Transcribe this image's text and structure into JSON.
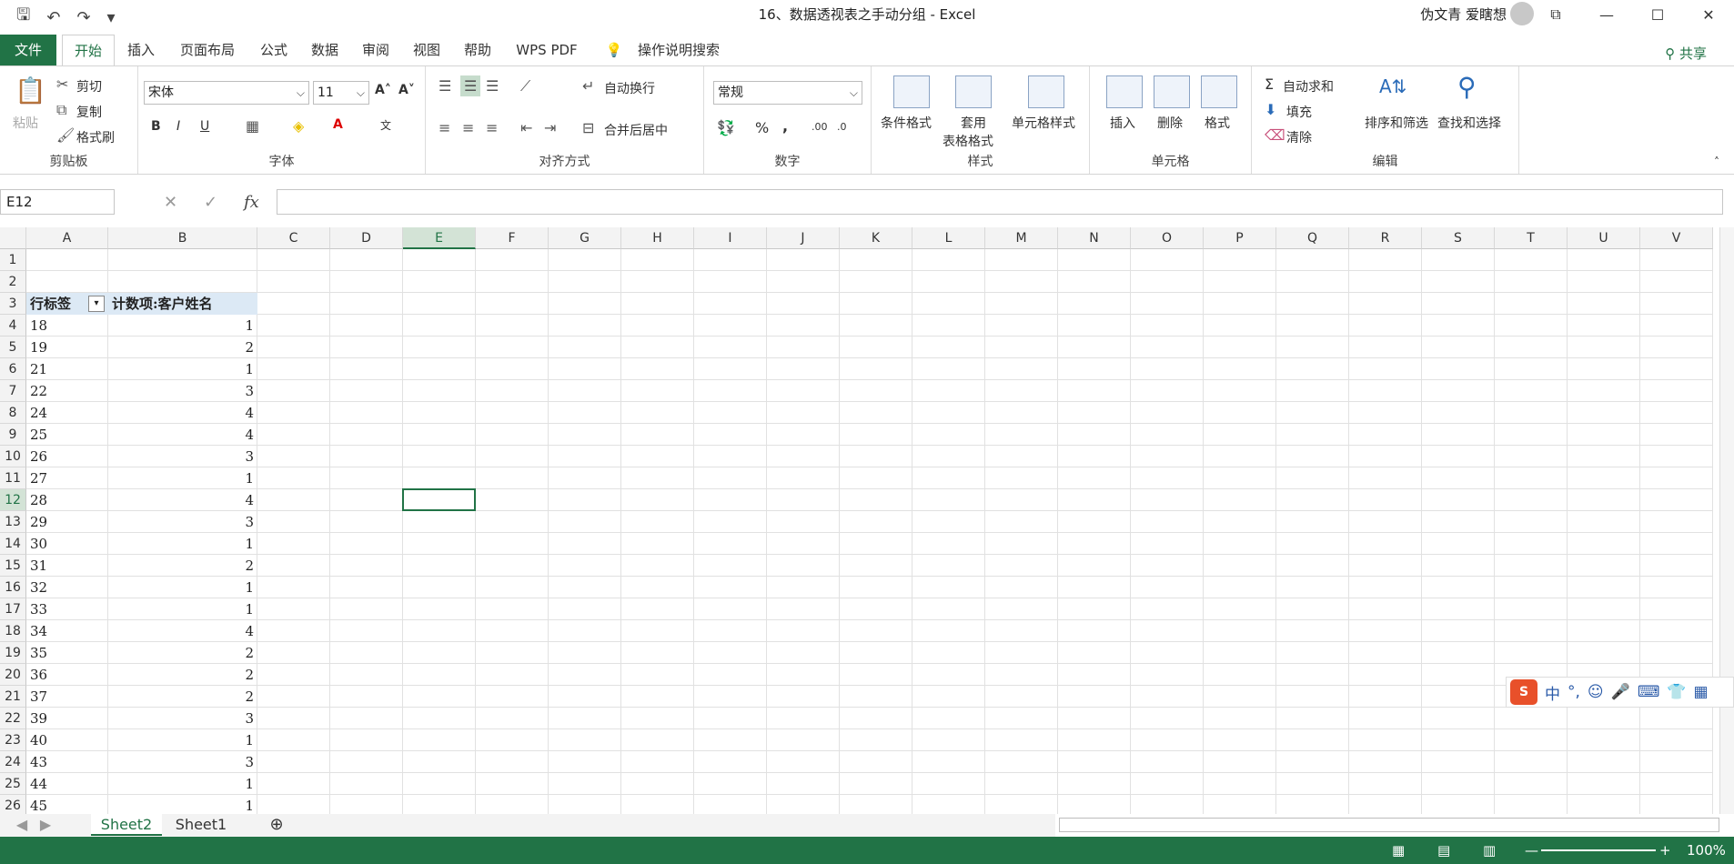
{
  "window": {
    "title": "16、数据透视表之手动分组  -  Excel",
    "user": "伪文青 爱瞎想"
  },
  "ribbon_tabs": [
    "文件",
    "开始",
    "插入",
    "页面布局",
    "公式",
    "数据",
    "审阅",
    "视图",
    "帮助",
    "WPS PDF",
    "操作说明搜索"
  ],
  "share_label": "共享",
  "clipboard": {
    "paste": "粘贴",
    "cut": "剪切",
    "copy": "复制",
    "format_painter": "格式刷",
    "label": "剪贴板"
  },
  "font": {
    "name": "宋体",
    "size": "11",
    "label": "字体"
  },
  "alignment": {
    "wrap": "自动换行",
    "merge": "合并后居中",
    "label": "对齐方式"
  },
  "number": {
    "format": "常规",
    "label": "数字"
  },
  "styles": {
    "conditional": "条件格式",
    "table_1": "套用",
    "table_2": "表格格式",
    "cell_styles": "单元格样式",
    "label": "样式"
  },
  "cells": {
    "insert": "插入",
    "delete": "删除",
    "format": "格式",
    "label": "单元格"
  },
  "editing": {
    "autosum": "自动求和",
    "fill": "填充",
    "clear": "清除",
    "sort": "排序和筛选",
    "find": "查找和选择",
    "label": "编辑"
  },
  "formula_bar": {
    "name_box": "E12",
    "fx": "fx",
    "value": ""
  },
  "columns": [
    "A",
    "B",
    "C",
    "D",
    "E",
    "F",
    "G",
    "H",
    "I",
    "J",
    "K",
    "L",
    "M",
    "N",
    "O",
    "P",
    "Q",
    "R",
    "S",
    "T",
    "U",
    "V"
  ],
  "pivot": {
    "row_label_header": "行标签",
    "value_header": "计数项:客户姓名",
    "rows": [
      {
        "label": "18",
        "count": "1"
      },
      {
        "label": "19",
        "count": "2"
      },
      {
        "label": "21",
        "count": "1"
      },
      {
        "label": "22",
        "count": "3"
      },
      {
        "label": "24",
        "count": "4"
      },
      {
        "label": "25",
        "count": "4"
      },
      {
        "label": "26",
        "count": "3"
      },
      {
        "label": "27",
        "count": "1"
      },
      {
        "label": "28",
        "count": "4"
      },
      {
        "label": "29",
        "count": "3"
      },
      {
        "label": "30",
        "count": "1"
      },
      {
        "label": "31",
        "count": "2"
      },
      {
        "label": "32",
        "count": "1"
      },
      {
        "label": "33",
        "count": "1"
      },
      {
        "label": "34",
        "count": "4"
      },
      {
        "label": "35",
        "count": "2"
      },
      {
        "label": "36",
        "count": "2"
      },
      {
        "label": "37",
        "count": "2"
      },
      {
        "label": "39",
        "count": "3"
      },
      {
        "label": "40",
        "count": "1"
      },
      {
        "label": "43",
        "count": "3"
      },
      {
        "label": "44",
        "count": "1"
      },
      {
        "label": "45",
        "count": "1"
      }
    ]
  },
  "sheets": [
    "Sheet2",
    "Sheet1"
  ],
  "status": {
    "zoom": "100%"
  },
  "ime": {
    "mode": "中"
  },
  "colors": {
    "accent": "#217346"
  }
}
